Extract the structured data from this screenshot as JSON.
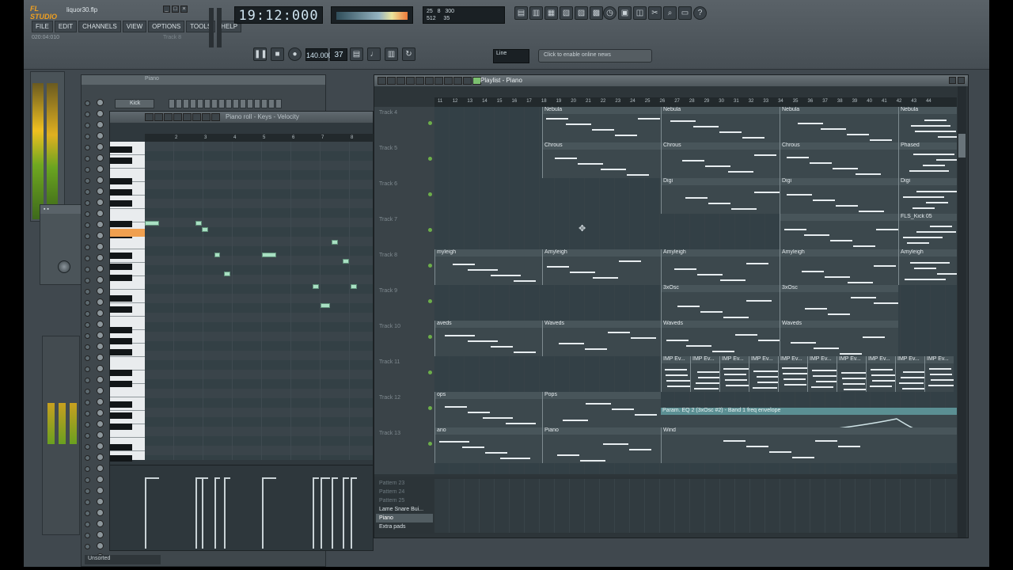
{
  "app": {
    "logo": "FL STUDIO",
    "filename": "liquor30.flp",
    "hint": "020:04:010",
    "hint_track": "Track 8"
  },
  "menu": [
    "FILE",
    "EDIT",
    "CHANNELS",
    "VIEW",
    "OPTIONS",
    "TOOLS",
    "HELP"
  ],
  "time": "19:12:000",
  "cpu": {
    "line1_a": "25",
    "line1_b": "8",
    "line1_c": "300",
    "line2_a": "512",
    "line2_b": "35"
  },
  "transport": {
    "tempo": "140.000",
    "pattern": "37",
    "snap": "Line"
  },
  "news": "Click to enable online news",
  "channel_rack": {
    "title": "Piano",
    "kick": "Kick",
    "unsorted": "Unsorted"
  },
  "piano_roll": {
    "title": "Piano roll - Keys - Velocity",
    "ruler": [
      "2",
      "3",
      "4",
      "5",
      "6",
      "7",
      "8"
    ]
  },
  "playlist": {
    "title": "Playlist - Piano",
    "ruler": [
      "11",
      "12",
      "13",
      "14",
      "15",
      "16",
      "17",
      "18",
      "19",
      "20",
      "21",
      "22",
      "23",
      "24",
      "25",
      "26",
      "27",
      "28",
      "29",
      "30",
      "31",
      "32",
      "33",
      "34",
      "35",
      "36",
      "37",
      "38",
      "39",
      "40",
      "41",
      "42",
      "43",
      "44"
    ],
    "tracks": [
      "Track 4",
      "Track 5",
      "Track 6",
      "Track 7",
      "Track 8",
      "Track 9",
      "Track 10",
      "Track 11",
      "Track 12",
      "Track 13"
    ],
    "clips": {
      "nebula": "Nebula",
      "chrous": "Chrous",
      "phased": "Phased",
      "digi": "Digi",
      "kick": "FLS_Kick 05",
      "amyleigh": "Amyleigh",
      "osc": "3xOsc",
      "waveds": "Waveds",
      "imp": "IMP Ev...",
      "pops": "Pops",
      "piano": "Piano",
      "wind": "Wind",
      "ano": "ano",
      "ops": "ops",
      "aveds": "aveds",
      "myleigh": "myleigh",
      "auto": "Param. EQ 2 (3xOsc #2) - Band 1 freq envelope"
    },
    "patterns": [
      "Pattern 23",
      "Pattern 24",
      "Pattern 25",
      "Lame Snare Bui...",
      "Piano",
      "Extra pads"
    ]
  },
  "colors": {
    "note": "#a9e0c3",
    "accent": "#f0a050",
    "playhead": "#f0a050"
  }
}
